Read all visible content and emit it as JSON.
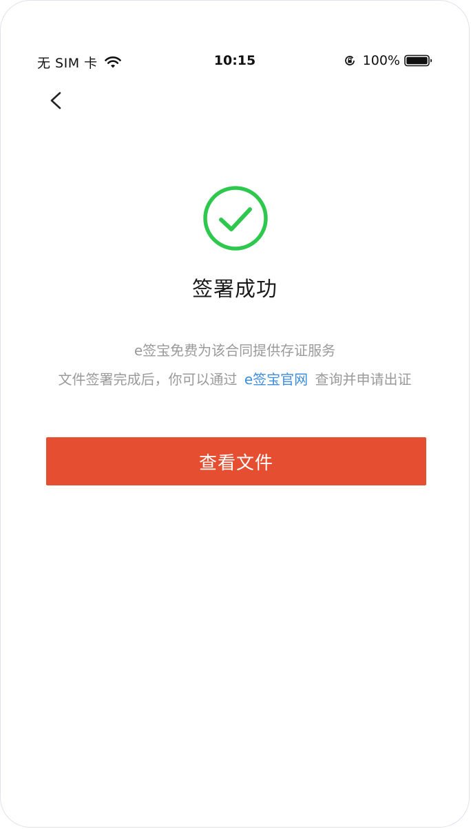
{
  "status_bar": {
    "carrier": "无 SIM 卡",
    "time": "10:15",
    "battery": "100%"
  },
  "nav": {
    "back_icon": "chevron-left-icon"
  },
  "result": {
    "icon": "check-circle-icon",
    "icon_color": "#2dc84d",
    "title": "签署成功",
    "desc_line_1": "e签宝免费为该合同提供存证服务",
    "desc_line_2_prefix": "文件签署完成后，你可以通过",
    "desc_line_2_link": "e签宝官网",
    "desc_line_2_suffix": "查询并申请出证"
  },
  "actions": {
    "view_file_label": "查看文件",
    "button_color": "#e54e30",
    "link_color": "#3c8dde"
  }
}
